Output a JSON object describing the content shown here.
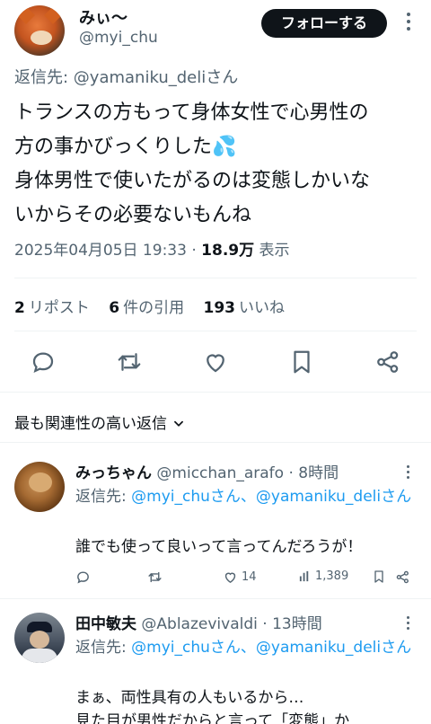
{
  "tweet": {
    "display_name": "みぃ〜",
    "handle": "@myi_chu",
    "follow_label": "フォローする",
    "reply_to_prefix": "返信先: ",
    "reply_to_user": "@yamaniku_deli",
    "reply_to_suffix": "さん",
    "text_line1": "トランスの方もって身体女性で心男性の",
    "text_line2": "方の事かびっくりした",
    "text_line3": "身体男性で使いたがるのは変態しかいな",
    "text_line4": "いからその必要ないもんね",
    "emoji": "💦",
    "date": "2025年04月05日 19:33",
    "dot": " · ",
    "views": "18.9万",
    "views_label": " 表示"
  },
  "stats": {
    "reposts_count": "2",
    "reposts_label": "リポスト",
    "quotes_count": "6",
    "quotes_label": "件の引用",
    "likes_count": "193",
    "likes_label": "いいね"
  },
  "sort_label": "最も関連性の高い返信",
  "replies": [
    {
      "name": "みっちゃん",
      "handle": "@micchan_arafo",
      "time": "8時間",
      "reply_to_prefix": "返信先: ",
      "reply_to_users": "@myi_chuさん、@yamaniku_deli",
      "reply_to_suffix": "さん",
      "text": "誰でも使って良いって言ってんだろうが！",
      "likes": "14",
      "views": "1,389"
    },
    {
      "name": "田中敏夫",
      "handle": "@Ablazevivaldi",
      "time": "13時間",
      "reply_to_prefix": "返信先: ",
      "reply_to_users": "@myi_chuさん、@yamaniku_deli",
      "reply_to_suffix": "さん",
      "text_line1": "まぁ、両性具有の人もいるから…",
      "text_line2": "見た目が男性だからと言って「変態」か"
    }
  ],
  "colors": {
    "accent": "#1d9bf0",
    "muted": "#536471",
    "text": "#0f1419"
  }
}
